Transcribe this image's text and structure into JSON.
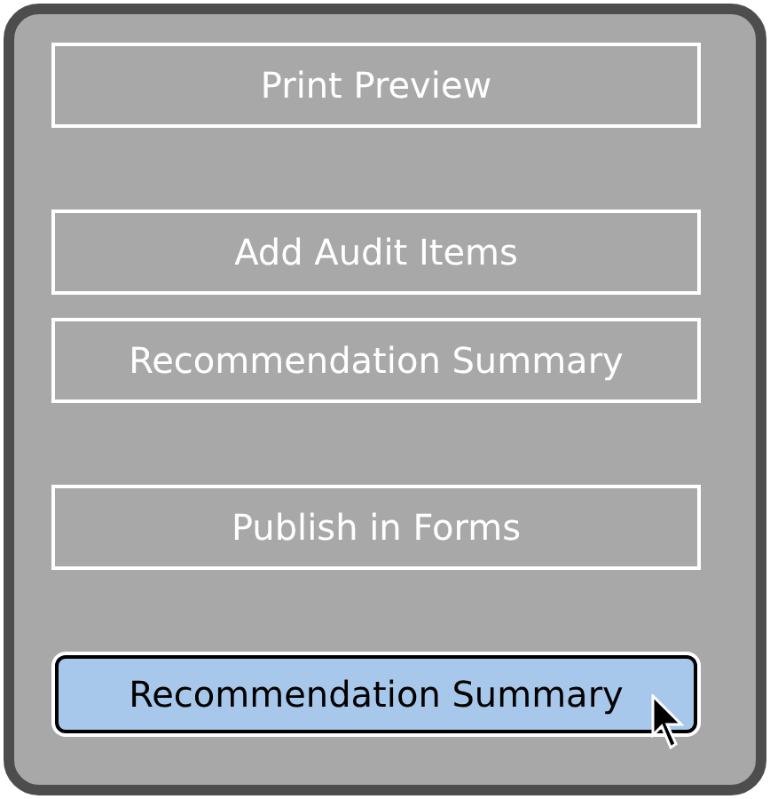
{
  "groups": [
    {
      "buttons": [
        {
          "label": "Print Preview",
          "selected": false,
          "hovered": false
        }
      ]
    },
    {
      "buttons": [
        {
          "label": "Add Audit Items",
          "selected": false,
          "hovered": false
        },
        {
          "label": "Recommendation Summary",
          "selected": false,
          "hovered": false
        }
      ]
    },
    {
      "buttons": [
        {
          "label": "Publish in Forms",
          "selected": false,
          "hovered": false
        }
      ]
    },
    {
      "buttons": [
        {
          "label": "Recommendation Summary",
          "selected": true,
          "hovered": true
        }
      ]
    }
  ]
}
